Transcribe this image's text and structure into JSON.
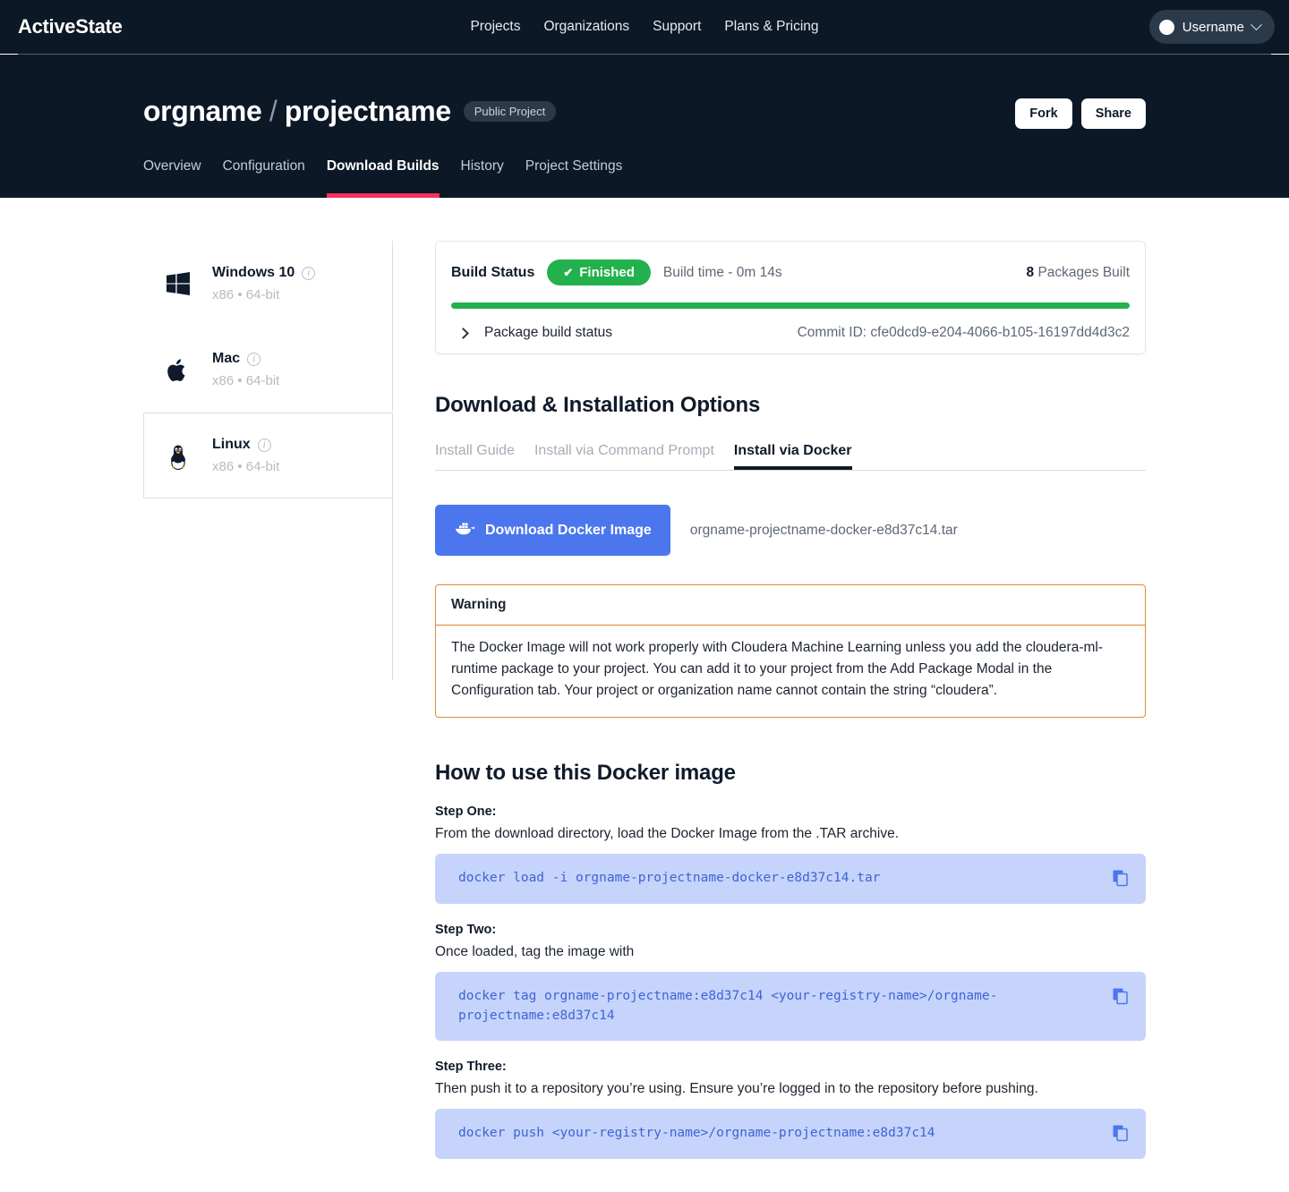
{
  "topbar": {
    "brand": "ActiveState",
    "nav": [
      "Projects",
      "Organizations",
      "Support",
      "Plans & Pricing"
    ],
    "user": {
      "label": "Username",
      "avatar_icon": "user-avatar-circle",
      "chevron_icon": "chevron-down-icon"
    }
  },
  "project": {
    "org": "orgname",
    "separator": "/",
    "name": "projectname",
    "visibility_badge": "Public Project",
    "actions": {
      "fork": "Fork",
      "share": "Share"
    },
    "tabs": [
      {
        "label": "Overview",
        "active": false
      },
      {
        "label": "Configuration",
        "active": false
      },
      {
        "label": "Download Builds",
        "active": true
      },
      {
        "label": "History",
        "active": false
      },
      {
        "label": "Project Settings",
        "active": false
      }
    ],
    "active_tab_underline_color": "#f6315c"
  },
  "platforms": [
    {
      "name": "Windows 10",
      "arch": "x86 • 64-bit",
      "icon": "windows-logo-icon",
      "selected": false
    },
    {
      "name": "Mac",
      "arch": "x86 • 64-bit",
      "icon": "apple-logo-icon",
      "selected": false
    },
    {
      "name": "Linux",
      "arch": "x86 • 64-bit",
      "icon": "linux-penguin-icon",
      "selected": true
    }
  ],
  "build_status": {
    "label": "Build Status",
    "state": "Finished",
    "state_color": "#22b14c",
    "check_icon": "check-icon",
    "build_time": "Build time - 0m 14s",
    "packages_count": "8",
    "packages_label": "Packages Built",
    "progress_percent": 100,
    "expand_icon": "chevron-right-icon",
    "package_build_status_label": "Package build status",
    "commit_id": "Commit ID: cfe0dcd9-e204-4066-b105-16197dd4d3c2"
  },
  "download_section": {
    "heading": "Download & Installation Options",
    "tabs": [
      {
        "label": "Install Guide",
        "active": false
      },
      {
        "label": "Install via Command Prompt",
        "active": false
      },
      {
        "label": "Install via Docker",
        "active": true
      }
    ],
    "download_button": "Download Docker Image",
    "docker_icon": "docker-whale-icon",
    "filename": "orgname-projectname-docker-e8d37c14.tar"
  },
  "warning": {
    "title": "Warning",
    "border_color": "#e08a2e",
    "text": "The Docker Image will not work properly with Cloudera Machine Learning unless you add the cloudera-ml-runtime package to your project. You can add it to your project from the Add Package Modal in the Configuration tab. Your project or organization name cannot contain the string “cloudera”."
  },
  "howto": {
    "heading": "How to use this Docker image",
    "copy_icon": "copy-icon",
    "steps": [
      {
        "label": "Step One:",
        "desc": "From the download directory, load the Docker Image from the .TAR archive.",
        "command": "docker load -i orgname-projectname-docker-e8d37c14.tar"
      },
      {
        "label": "Step Two:",
        "desc": "Once loaded, tag the image with",
        "command": "docker tag orgname-projectname:e8d37c14 <your-registry-name>/orgname-projectname:e8d37c14"
      },
      {
        "label": "Step Three:",
        "desc": "Then push it to a repository you’re using. Ensure you’re logged in to the repository before pushing.",
        "command": "docker push <your-registry-name>/orgname-projectname:e8d37c14"
      }
    ]
  }
}
